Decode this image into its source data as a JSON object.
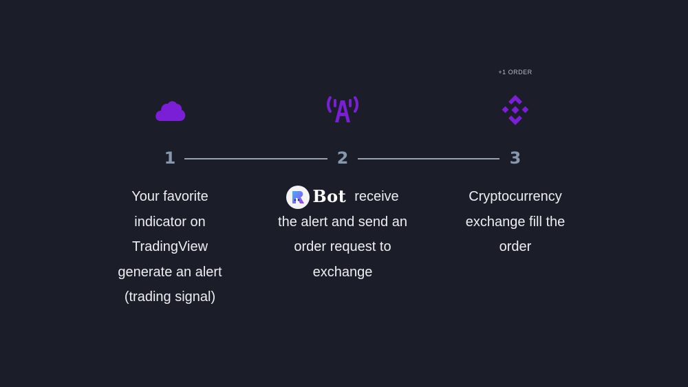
{
  "accent_color": "#7a1fd6",
  "steps": [
    {
      "number": "1",
      "icon": "cloud-icon",
      "description_lines": [
        "Your favorite",
        "indicator on",
        "TradingView",
        "generate an alert",
        "(trading signal)"
      ]
    },
    {
      "number": "2",
      "icon": "antenna-icon",
      "brand": "Bot",
      "brand_suffix": "receive",
      "description_lines": [
        "the alert and send an",
        "order request to",
        "exchange"
      ]
    },
    {
      "number": "3",
      "icon": "binance-icon",
      "tag": "+1 ORDER",
      "description_lines": [
        "Cryptocurrency",
        "exchange fill the",
        "order"
      ]
    }
  ]
}
